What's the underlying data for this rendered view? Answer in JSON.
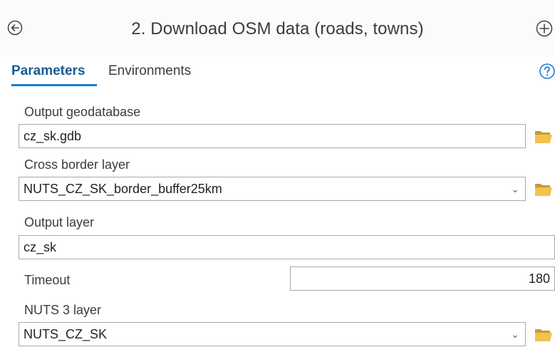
{
  "header": {
    "title": "2. Download OSM data (roads, towns)"
  },
  "tabs": [
    {
      "label": "Parameters",
      "active": true
    },
    {
      "label": "Environments",
      "active": false
    }
  ],
  "params": {
    "output_geodatabase": {
      "label": "Output geodatabase",
      "value": "cz_sk.gdb"
    },
    "cross_border_layer": {
      "label": "Cross border layer",
      "value": "NUTS_CZ_SK_border_buffer25km"
    },
    "output_layer": {
      "label": "Output layer",
      "value": "cz_sk"
    },
    "timeout": {
      "label": "Timeout",
      "value": "180"
    },
    "nuts3_layer": {
      "label": "NUTS 3 layer",
      "value": "NUTS_CZ_SK"
    }
  },
  "icons": {
    "back": "back-arrow-circle-icon",
    "add": "plus-circle-icon",
    "help": "help-question-icon",
    "folder": "folder-open-icon",
    "dropdown": "chevron-down-icon"
  },
  "colors": {
    "accent": "#1e7bd1",
    "active_tab_text": "#1a5a96",
    "folder": "#e8b43c",
    "field_border": "#a9a9a9"
  }
}
